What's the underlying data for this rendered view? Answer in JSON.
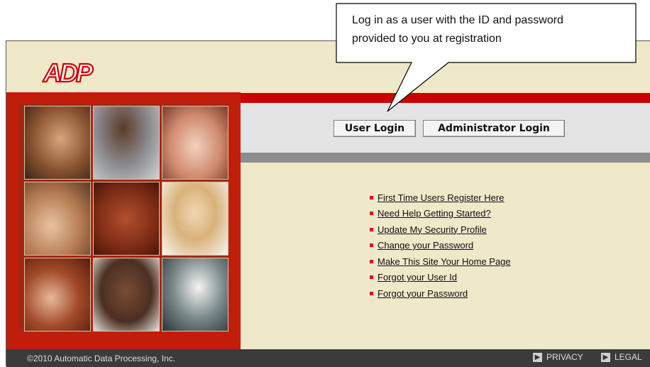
{
  "brand": {
    "logo_text": "ADP"
  },
  "login": {
    "user_label": "User Login",
    "admin_label": "Administrator Login"
  },
  "links": [
    "First Time Users Register Here",
    "Need Help Getting Started?",
    "Update My Security Profile",
    "Change your Password",
    "Make This Site Your Home Page",
    "Forgot your User Id",
    "Forgot your Password"
  ],
  "footer": {
    "copyright": "©2010 Automatic Data Processing, Inc.",
    "privacy": "PRIVACY",
    "legal": "LEGAL"
  },
  "callout": {
    "text": "Log in as a user with the ID and password provided to you at registration"
  },
  "colors": {
    "accent_red": "#cc0000",
    "panel_red": "#c01e0a",
    "background_cream": "#efe8c9"
  }
}
